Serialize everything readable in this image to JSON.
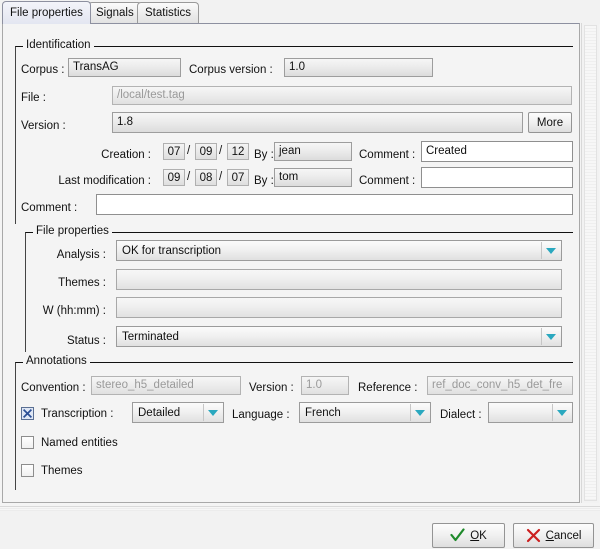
{
  "tabs": [
    {
      "label": "File properties",
      "active": true
    },
    {
      "label": "Signals",
      "active": false
    },
    {
      "label": "Statistics",
      "active": false
    }
  ],
  "identification": {
    "group_label": "Identification",
    "corpus_label": "Corpus :",
    "corpus_value": "TransAG",
    "corpus_version_label": "Corpus version :",
    "corpus_version_value": "1.0",
    "file_label": "File :",
    "file_value": "/local/test.tag",
    "version_label": "Version :",
    "version_value": "1.8",
    "more_label": "More",
    "creation_label": "Creation :",
    "creation_day": "07",
    "creation_month": "09",
    "creation_year": "12",
    "creation_by_label": "By :",
    "creation_by_value": "jean",
    "creation_comment_label": "Comment :",
    "creation_comment_value": "Created",
    "lastmod_label": "Last modification :",
    "lastmod_day": "09",
    "lastmod_month": "08",
    "lastmod_year": "07",
    "lastmod_by_label": "By :",
    "lastmod_by_value": "tom",
    "lastmod_comment_label": "Comment :",
    "lastmod_comment_value": "",
    "comment_label": "Comment :",
    "comment_value": "",
    "date_separator": "/"
  },
  "file_properties": {
    "group_label": "File properties",
    "analysis_label": "Analysis :",
    "analysis_value": "OK for transcription",
    "themes_label": "Themes :",
    "themes_value": "",
    "w_label": "W (hh:mm) :",
    "w_value": "",
    "status_label": "Status :",
    "status_value": "Terminated"
  },
  "annotations": {
    "group_label": "Annotations",
    "convention_label": "Convention :",
    "convention_value": "stereo_h5_detailed",
    "version_label": "Version :",
    "version_value": "1.0",
    "reference_label": "Reference :",
    "reference_value": "ref_doc_conv_h5_det_fre",
    "transcription_label": "Transcription :",
    "transcription_checked": true,
    "transcription_value": "Detailed",
    "language_label": "Language :",
    "language_value": "French",
    "dialect_label": "Dialect :",
    "dialect_value": "",
    "named_entities_label": "Named entities",
    "named_entities_checked": false,
    "themes_label": "Themes",
    "themes_checked": false
  },
  "footer": {
    "ok_label_prefix": "O",
    "ok_label_rest": "K",
    "cancel_label_prefix": "C",
    "cancel_label_rest": "ancel"
  },
  "colors": {
    "accent_tab": "#e8eaf3",
    "combo_arrow": "#2aa8bf",
    "ok_check": "#1f8a2b",
    "cancel_x": "#cc1f1f",
    "checkbox_mark": "#2b4f96"
  }
}
